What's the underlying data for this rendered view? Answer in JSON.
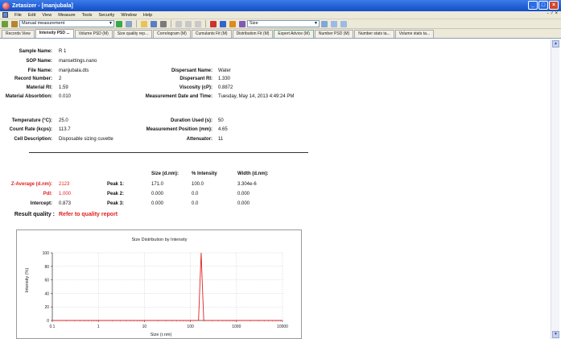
{
  "window": {
    "title": "Zetasizer - [manjubala]"
  },
  "menu": [
    "File",
    "Edit",
    "View",
    "Measure",
    "Tools",
    "Security",
    "Window",
    "Help"
  ],
  "toolbar": {
    "measurement_combo": "Manual measurement",
    "size_combo": "Size"
  },
  "tabs": [
    "Records View",
    "Intensity PSD ...",
    "Volume PSD (M)",
    "Size quality rep...",
    "Correlogram (M)",
    "Cumulants Fit (M)",
    "Distribution Fit (M)",
    "Expert Advice (M)",
    "Number PSD (M)",
    "Number stats ta...",
    "Volume stats ta..."
  ],
  "info": {
    "sample_name_label": "Sample Name:",
    "sample_name": "R 1",
    "sop_name_label": "SOP Name:",
    "sop_name": "mansettings.nano",
    "file_name_label": "File Name:",
    "file_name": "manjubala.dts",
    "record_number_label": "Record Number:",
    "record_number": "2",
    "material_ri_label": "Material RI:",
    "material_ri": "1.59",
    "material_absorption_label": "Material Absorbtion:",
    "material_absorption": "0.010",
    "dispersant_name_label": "Dispersant Name:",
    "dispersant_name": "Water",
    "dispersant_ri_label": "Dispersant RI:",
    "dispersant_ri": "1.330",
    "viscosity_label": "Viscosity (cP):",
    "viscosity": "0.8872",
    "measurement_date_label": "Measurement Date and Time:",
    "measurement_date": "Tuesday, May 14, 2013 4:49:24 PM",
    "temperature_label": "Temperature (°C):",
    "temperature": "25.0",
    "count_rate_label": "Count Rate (kcps):",
    "count_rate": "113.7",
    "cell_description_label": "Cell Description:",
    "cell_description": "Disposable sizing cuvette",
    "duration_label": "Duration Used (s):",
    "duration": "50",
    "position_label": "Measurement Position (mm):",
    "position": "4.65",
    "attenuator_label": "Attenuator:",
    "attenuator": "11"
  },
  "results": {
    "col_size": "Size (d.nm):",
    "col_intensity": "% Intensity",
    "col_width": "Width (d.nm):",
    "z_average_label": "Z-Average (d.nm):",
    "z_average": "2123",
    "pdi_label": "PdI:",
    "pdi": "1.000",
    "intercept_label": "Intercept:",
    "intercept": "0.873",
    "peaks": [
      {
        "label": "Peak 1:",
        "size": "171.0",
        "intensity": "100.0",
        "width": "3.304e-6"
      },
      {
        "label": "Peak 2:",
        "size": "0.000",
        "intensity": "0.0",
        "width": "0.000"
      },
      {
        "label": "Peak 3:",
        "size": "0.000",
        "intensity": "0.0",
        "width": "0.000"
      }
    ],
    "quality_label": "Result quality :",
    "quality": "Refer to quality report"
  },
  "chart_data": {
    "type": "line",
    "title": "Size Distribution by Intensity",
    "xlabel": "Size (r.nm)",
    "ylabel": "Intensity (%)",
    "x_scale": "log",
    "xlim": [
      0.1,
      10000
    ],
    "ylim": [
      0,
      100
    ],
    "x_ticks": [
      "0.1",
      "1",
      "10",
      "100",
      "1000",
      "10000"
    ],
    "y_ticks": [
      "0",
      "20",
      "40",
      "60",
      "80",
      "100"
    ],
    "grid": true,
    "series": [
      {
        "x": [
          0.1,
          140,
          150,
          160,
          171,
          182,
          195,
          210,
          10000
        ],
        "y": [
          0,
          0,
          0,
          50,
          100,
          50,
          0,
          0,
          0
        ]
      }
    ],
    "colors": {
      "line": "#e02020"
    }
  }
}
